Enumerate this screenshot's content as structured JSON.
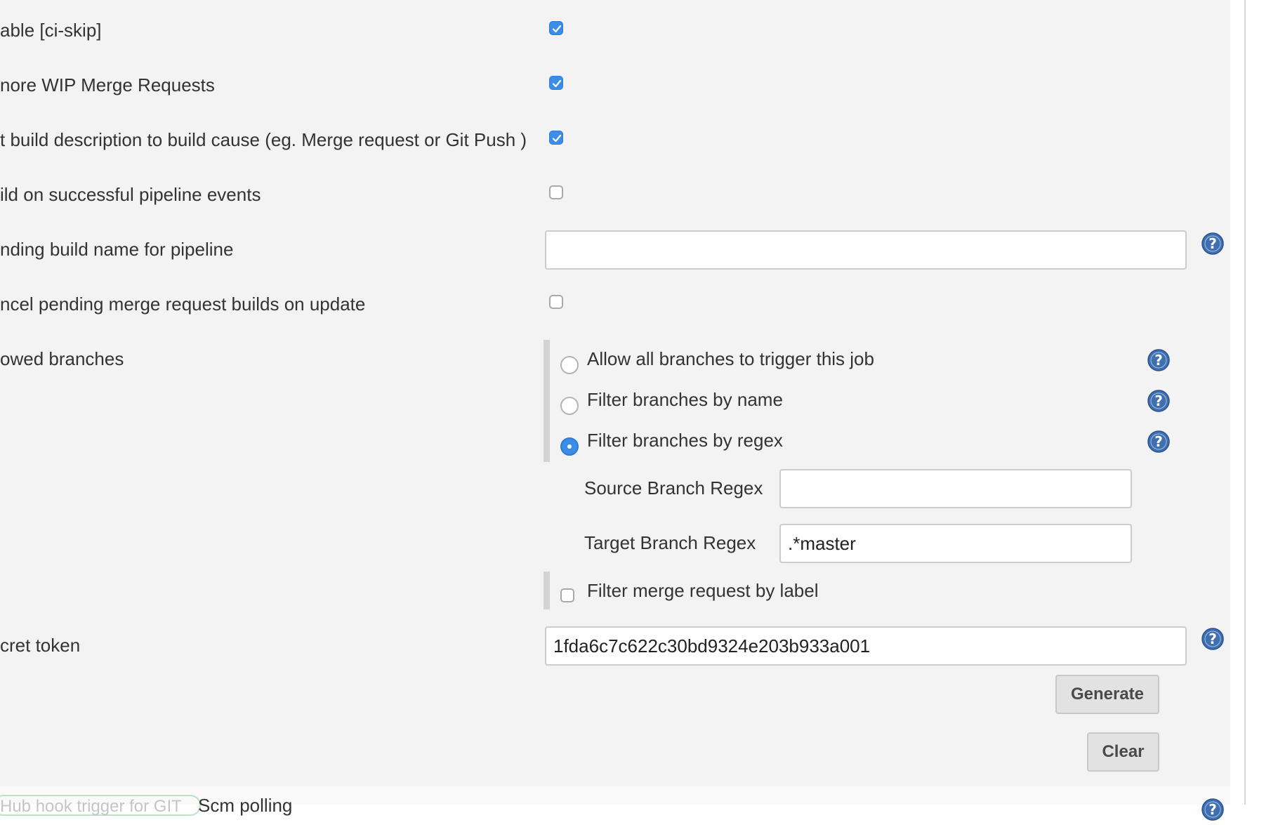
{
  "options": {
    "ci_skip": {
      "label": "able [ci-skip]",
      "checked": true
    },
    "ignore_wip": {
      "label": "nore WIP Merge Requests",
      "checked": true
    },
    "set_build_description": {
      "label": "t build description to build cause (eg. Merge request or Git Push )",
      "checked": true
    },
    "build_on_pipeline": {
      "label": "ild on successful pipeline events",
      "checked": false
    },
    "pending_build_name": {
      "label": "nding build name for pipeline",
      "value": ""
    },
    "cancel_pending": {
      "label": "ncel pending merge request builds on update",
      "checked": false
    }
  },
  "allowed_branches": {
    "label": "owed branches",
    "choices": [
      {
        "label": "Allow all branches to trigger this job",
        "selected": false
      },
      {
        "label": "Filter branches by name",
        "selected": false
      },
      {
        "label": "Filter branches by regex",
        "selected": true
      }
    ],
    "source_regex": {
      "label": "Source Branch Regex",
      "value": ""
    },
    "target_regex": {
      "label": "Target Branch Regex",
      "value": ".*master"
    },
    "filter_by_label": {
      "label": "Filter merge request by label",
      "checked": false
    }
  },
  "secret_token": {
    "label": "cret token",
    "value": "1fda6c7c622c30bd9324e203b933a001",
    "generate_label": "Generate",
    "clear_label": "Clear"
  },
  "next_row": {
    "faded_text": "Hub hook trigger for GIT",
    "text": "Scm polling"
  },
  "colors": {
    "accent": "#3b8de8",
    "panel_bg": "#f3f3f3",
    "help_icon": "#3f6fae"
  }
}
